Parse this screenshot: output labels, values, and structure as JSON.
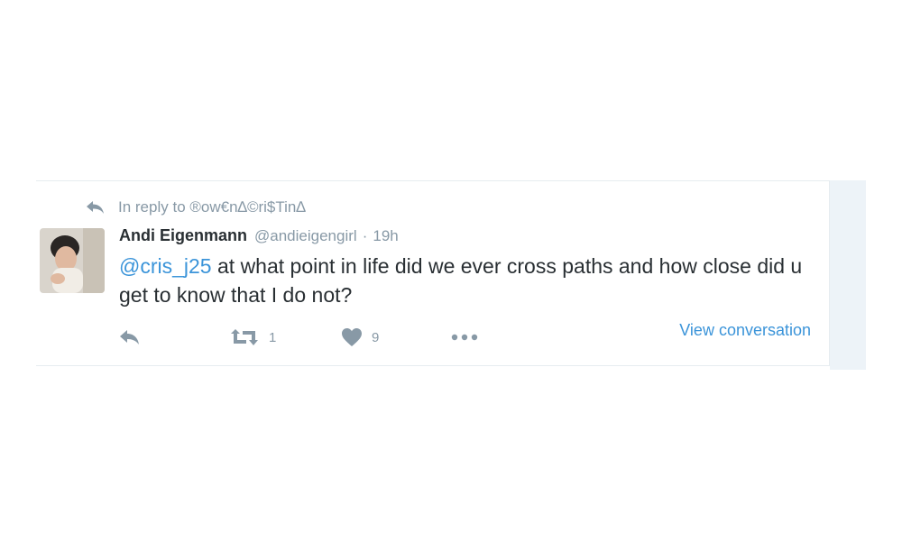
{
  "tweet": {
    "reply_context": "In reply to ®ow€n∆©ri$Tin∆",
    "author": {
      "name": "Andi Eigenmann",
      "handle": "@andieigengirl",
      "separator": "·",
      "time": "19h"
    },
    "text": {
      "mention": "@cris_j25",
      "body": " at what point in life did we ever cross paths and how close did u get to know that I do not?"
    },
    "actions": {
      "reply_icon": "reply-icon",
      "retweet_icon": "retweet-icon",
      "retweet_count": "1",
      "like_icon": "heart-icon",
      "like_count": "9",
      "more_icon": "more-dots-icon"
    },
    "view_conversation": "View conversation"
  },
  "colors": {
    "link": "#3b94d9",
    "muted": "#8899a6",
    "text": "#292f33",
    "side_strip": "#edf3f8"
  }
}
